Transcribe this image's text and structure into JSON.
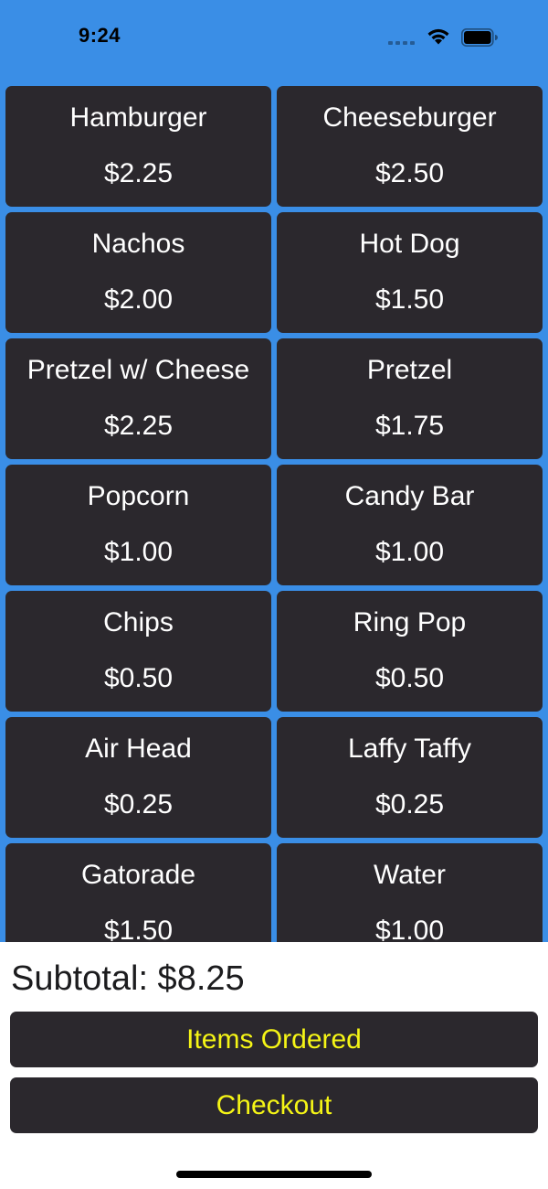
{
  "status_bar": {
    "time": "9:24"
  },
  "menu": {
    "items": [
      {
        "name": "Hamburger",
        "price": "$2.25"
      },
      {
        "name": "Cheeseburger",
        "price": "$2.50"
      },
      {
        "name": "Nachos",
        "price": "$2.00"
      },
      {
        "name": "Hot Dog",
        "price": "$1.50"
      },
      {
        "name": "Pretzel w/ Cheese",
        "price": "$2.25"
      },
      {
        "name": "Pretzel",
        "price": "$1.75"
      },
      {
        "name": "Popcorn",
        "price": "$1.00"
      },
      {
        "name": "Candy Bar",
        "price": "$1.00"
      },
      {
        "name": "Chips",
        "price": "$0.50"
      },
      {
        "name": "Ring Pop",
        "price": "$0.50"
      },
      {
        "name": "Air Head",
        "price": "$0.25"
      },
      {
        "name": "Laffy Taffy",
        "price": "$0.25"
      },
      {
        "name": "Gatorade",
        "price": "$1.50"
      },
      {
        "name": "Water",
        "price": "$1.00"
      }
    ]
  },
  "order": {
    "subtotal_text": "Subtotal: $8.25",
    "items_ordered_label": "Items Ordered",
    "checkout_label": "Checkout"
  },
  "colors": {
    "background": "#3a8ee6",
    "tile": "#2b282d",
    "button_text": "#f5f516"
  },
  "icons": {
    "signal": "cellular-signal-icon",
    "wifi": "wifi-icon",
    "battery": "battery-icon"
  }
}
